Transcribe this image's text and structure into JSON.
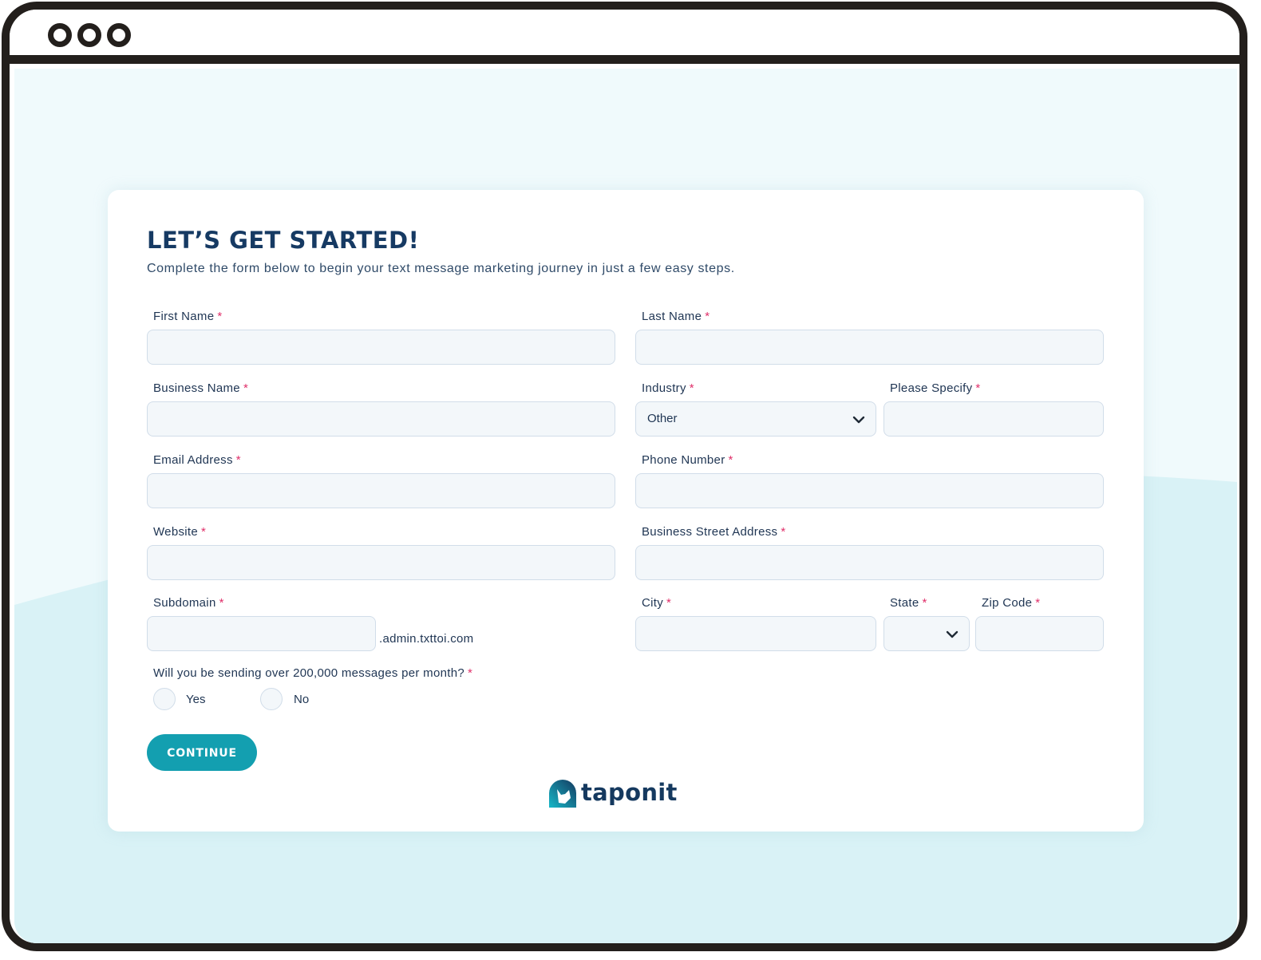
{
  "window": {
    "controls": [
      "window-dot",
      "window-dot",
      "window-dot"
    ]
  },
  "form": {
    "title": "LET’S GET STARTED!",
    "subtitle": "Complete the form below to begin your text message marketing journey in just a few easy steps.",
    "required_marker": "*",
    "fields": {
      "first_name": {
        "label": "First Name",
        "value": ""
      },
      "last_name": {
        "label": "Last Name",
        "value": ""
      },
      "business_name": {
        "label": "Business Name",
        "value": ""
      },
      "industry": {
        "label": "Industry",
        "selected": "Other"
      },
      "please_specify": {
        "label": "Please Specify",
        "value": ""
      },
      "email": {
        "label": "Email Address",
        "value": ""
      },
      "phone": {
        "label": "Phone Number",
        "value": ""
      },
      "website": {
        "label": "Website",
        "value": ""
      },
      "street": {
        "label": "Business Street Address",
        "value": ""
      },
      "subdomain": {
        "label": "Subdomain",
        "value": "",
        "suffix": ".admin.txttoi.com"
      },
      "city": {
        "label": "City",
        "value": ""
      },
      "state": {
        "label": "State",
        "selected": ""
      },
      "zip": {
        "label": "Zip Code",
        "value": ""
      }
    },
    "question": {
      "label": "Will you be sending over 200,000 messages per month?",
      "options": [
        "Yes",
        "No"
      ]
    },
    "continue_label": "CONTINUE"
  },
  "brand": {
    "name": "taponit",
    "primary_color": "#139fb0",
    "heading_color": "#163a63",
    "required_color": "#e0306a"
  }
}
